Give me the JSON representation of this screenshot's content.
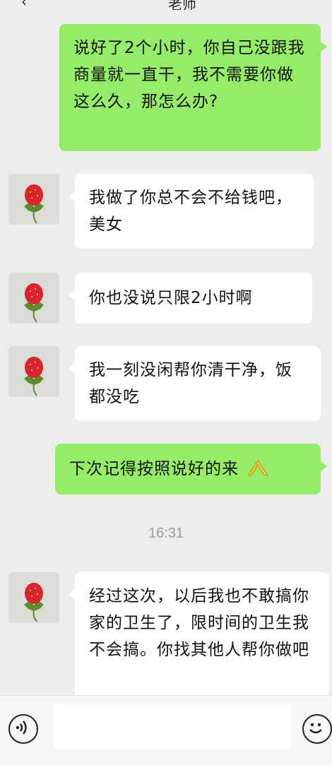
{
  "header": {
    "back_icon": "‹",
    "title": "老师"
  },
  "messages": [
    {
      "side": "out",
      "text": "说好了2个小时，你自己没跟我商量就一直干，我不需要你做这么久，那怎么办?"
    },
    {
      "side": "in",
      "text": "我做了你总不会不给钱吧，美女"
    },
    {
      "side": "in",
      "text": "你也没说只限2小时啊"
    },
    {
      "side": "in",
      "text": "我一刻没闲帮你清干净，饭都没吃"
    },
    {
      "side": "out",
      "text": "下次记得按照说好的来",
      "emoji": "praying-hands-icon"
    },
    {
      "side": "in",
      "text": "经过这次，以后我也不敢搞你家的卫生了，限时间的卫生我不会搞。你找其他人帮你做吧"
    }
  ],
  "timestamp": "16:31",
  "input_bar": {
    "voice_icon": "voice-icon",
    "emoji_icon": "smiley-icon",
    "input_value": ""
  },
  "colors": {
    "background": "#ededed",
    "outgoing_bubble": "#95ec69",
    "incoming_bubble": "#ffffff",
    "timestamp_text": "#9a9a9a"
  }
}
